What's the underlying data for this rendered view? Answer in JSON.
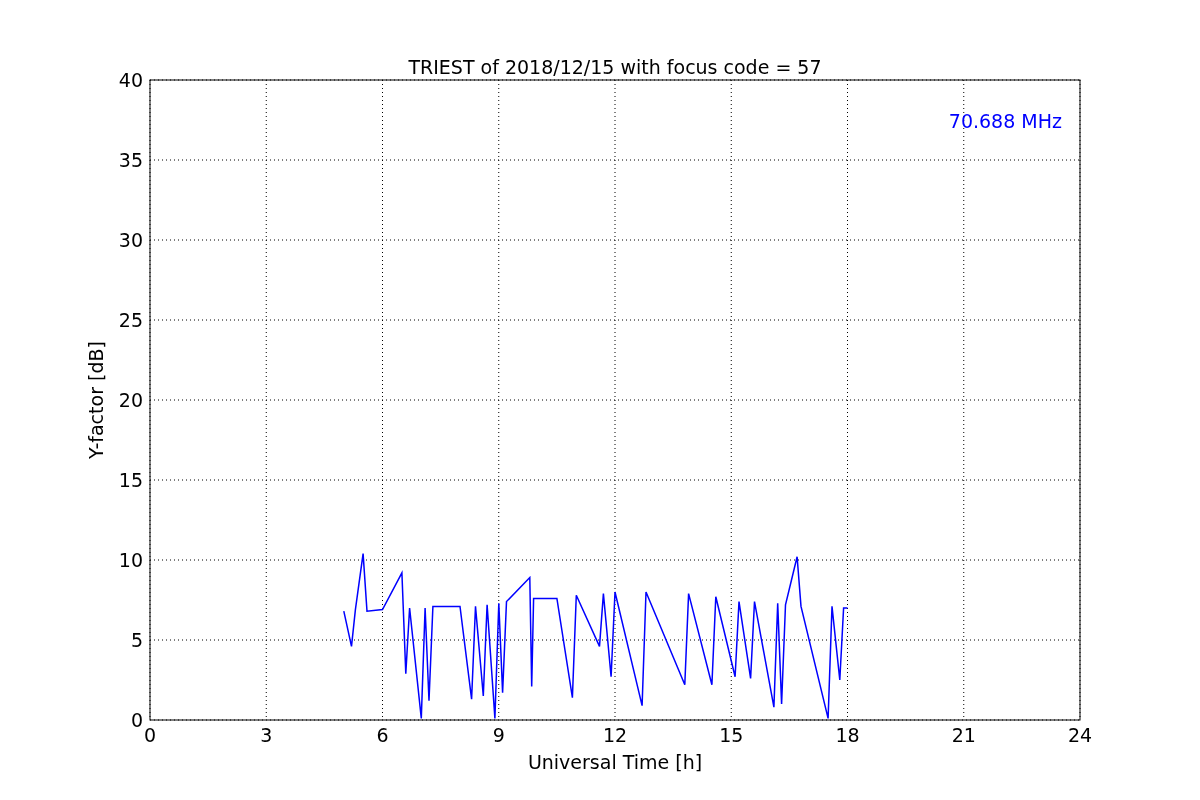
{
  "figure": {
    "chart_data": {
      "type": "line",
      "title": "TRIEST of 2018/12/15 with focus code = 57",
      "xlabel": "Universal Time [h]",
      "ylabel": "Y-factor [dB]",
      "x": [
        5.0,
        5.2,
        5.3,
        5.5,
        5.6,
        6.0,
        6.5,
        6.6,
        6.7,
        7.0,
        7.1,
        7.2,
        7.3,
        8.0,
        8.3,
        8.4,
        8.6,
        8.7,
        8.9,
        9.0,
        9.1,
        9.2,
        9.8,
        9.85,
        9.9,
        10.5,
        10.9,
        11.0,
        11.6,
        11.7,
        11.9,
        12.0,
        12.7,
        12.8,
        13.8,
        13.9,
        14.5,
        14.6,
        15.1,
        15.2,
        15.5,
        15.6,
        16.1,
        16.2,
        16.3,
        16.4,
        16.7,
        16.8,
        17.5,
        17.6,
        17.8,
        17.9,
        18.0
      ],
      "series": [
        {
          "name": "70.688 MHz",
          "color": "#0000ff",
          "values": [
            6.8,
            4.6,
            6.9,
            10.4,
            6.8,
            6.9,
            9.2,
            2.9,
            7.0,
            0.1,
            7.0,
            1.2,
            7.1,
            7.1,
            1.3,
            7.1,
            1.5,
            7.2,
            0.1,
            7.3,
            1.7,
            7.4,
            8.9,
            2.1,
            7.6,
            7.6,
            1.4,
            7.8,
            4.6,
            7.9,
            2.7,
            8.0,
            0.9,
            8.0,
            2.2,
            7.9,
            2.2,
            7.7,
            2.7,
            7.4,
            2.6,
            7.4,
            0.8,
            7.3,
            1.0,
            7.2,
            10.2,
            7.1,
            0.1,
            7.1,
            2.5,
            7.0,
            7.0
          ]
        }
      ],
      "xlim": [
        0,
        24
      ],
      "ylim": [
        0,
        40
      ],
      "xticks": [
        0,
        3,
        6,
        9,
        12,
        15,
        18,
        21,
        24
      ],
      "yticks": [
        0,
        5,
        10,
        15,
        20,
        25,
        30,
        35,
        40
      ],
      "grid": true
    }
  }
}
